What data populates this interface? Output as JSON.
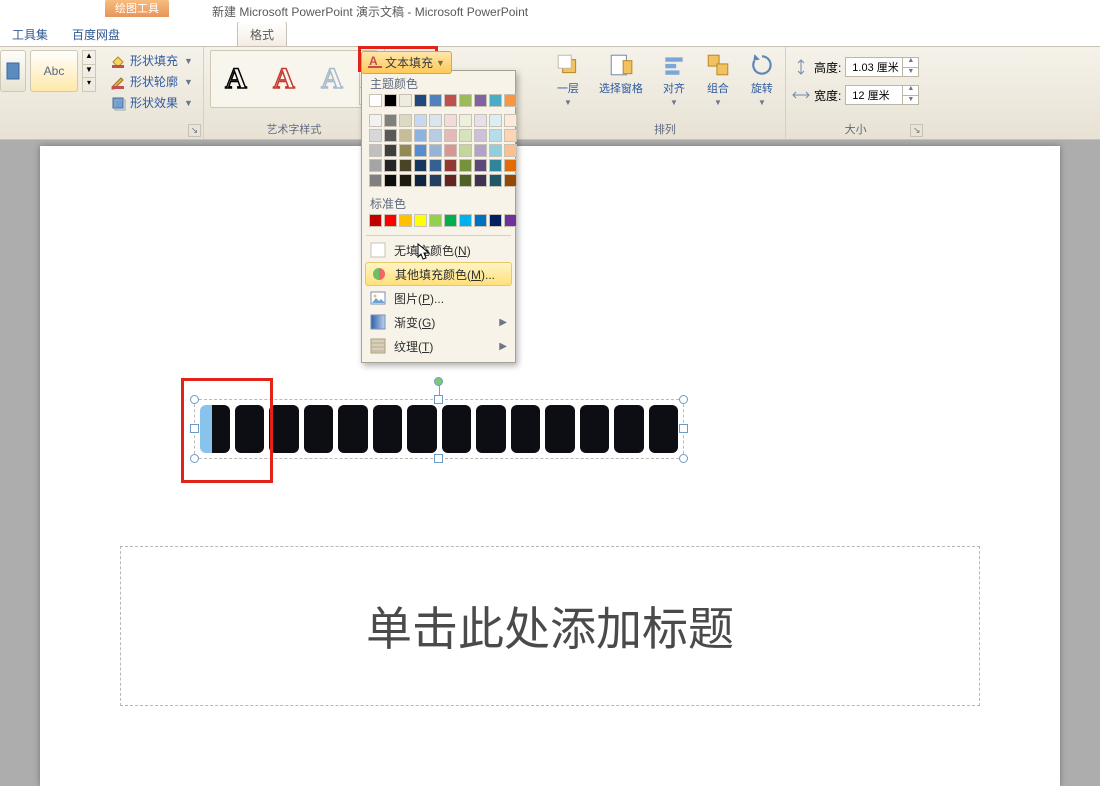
{
  "window": {
    "title": "新建 Microsoft PowerPoint 演示文稿 - Microsoft PowerPoint"
  },
  "contextualTab": {
    "caption": "绘图工具"
  },
  "tabs": {
    "tools": "工具集",
    "baidu": "百度网盘",
    "format": "格式"
  },
  "ribbon": {
    "shapeFill": "形状填充",
    "shapeOutline": "形状轮廓",
    "shapeEffects": "形状效果",
    "abc": "Abc",
    "wordartGroup": "艺术字样式",
    "arrangeGroup": "排列",
    "sizeGroup": "大小",
    "bringLayer": "一层",
    "selectionPane": "选择窗格",
    "align": "对齐",
    "group": "组合",
    "rotate": "旋转",
    "heightLabel": "高度:",
    "widthLabel": "宽度:",
    "height": "1.03 厘米",
    "width": "12 厘米"
  },
  "trigger": {
    "label": "文本填充"
  },
  "dropdown": {
    "themeColors": "主题颜色",
    "standardColors": "标准色",
    "noFill": "无填充颜色",
    "noFillKey": "N",
    "moreColors": "其他填充颜色",
    "moreColorsKey": "M",
    "picture": "图片",
    "pictureKey": "P",
    "gradient": "渐变",
    "gradientKey": "G",
    "texture": "纹理",
    "textureKey": "T",
    "themeRow1": [
      "#ffffff",
      "#000000",
      "#eeece1",
      "#1f497d",
      "#4f81bd",
      "#c0504d",
      "#9bbb59",
      "#8064a2",
      "#4bacc6",
      "#f79646"
    ],
    "themeShades": [
      [
        "#f2f2f2",
        "#7f7f7f",
        "#ddd9c3",
        "#c6d9f0",
        "#dbe5f1",
        "#f2dcdb",
        "#ebf1dd",
        "#e5e0ec",
        "#dbeef3",
        "#fdeada"
      ],
      [
        "#d8d8d8",
        "#595959",
        "#c4bd97",
        "#8db3e2",
        "#b8cce4",
        "#e5b9b7",
        "#d7e3bc",
        "#ccc1d9",
        "#b7dde8",
        "#fbd5b5"
      ],
      [
        "#bfbfbf",
        "#3f3f3f",
        "#938953",
        "#548dd4",
        "#95b3d7",
        "#d99694",
        "#c3d69b",
        "#b2a2c7",
        "#92cddc",
        "#fac08f"
      ],
      [
        "#a5a5a5",
        "#262626",
        "#494429",
        "#17365d",
        "#366092",
        "#953734",
        "#76923c",
        "#5f497a",
        "#31859b",
        "#e36c09"
      ],
      [
        "#7f7f7f",
        "#0c0c0c",
        "#1d1b10",
        "#0f243e",
        "#244061",
        "#632423",
        "#4f6128",
        "#3f3151",
        "#205867",
        "#974806"
      ]
    ],
    "standardRow": [
      "#c00000",
      "#ff0000",
      "#ffc000",
      "#ffff00",
      "#92d050",
      "#00b050",
      "#00b0f0",
      "#0070c0",
      "#002060",
      "#7030a0"
    ]
  },
  "slide": {
    "titlePlaceholder": "单击此处添加标题"
  }
}
